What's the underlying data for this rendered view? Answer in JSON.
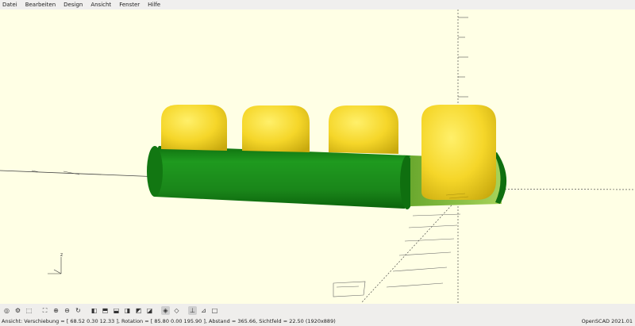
{
  "menu": [
    "Datei",
    "Bearbeiten",
    "Design",
    "Ansicht",
    "Fenster",
    "Hilfe"
  ],
  "viewport": {
    "background": "#ffffe5",
    "colors": {
      "green": "#1e8d1e",
      "yellow": "#f4d62a",
      "side_green": "#9acd50"
    },
    "axis_label_z": "z"
  },
  "toolbar": [
    {
      "name": "preview-icon"
    },
    {
      "name": "render-icon"
    },
    {
      "name": "export-stl-icon"
    },
    {
      "name": "view-all-icon"
    },
    {
      "name": "zoom-in-icon"
    },
    {
      "name": "zoom-out-icon"
    },
    {
      "name": "reset-view-icon"
    },
    {
      "name": "view-right-icon"
    },
    {
      "name": "view-top-icon"
    },
    {
      "name": "view-bottom-icon"
    },
    {
      "name": "view-left-icon"
    },
    {
      "name": "view-front-icon"
    },
    {
      "name": "view-back-icon"
    },
    {
      "name": "perspective-icon"
    },
    {
      "name": "orthogonal-icon"
    },
    {
      "name": "show-axes-icon"
    },
    {
      "name": "show-scale-icon"
    },
    {
      "name": "show-edges-icon"
    }
  ],
  "status": {
    "left": "Ansicht: Verschiebung = [ 68.52 0.30 12.33 ], Rotation = [ 85.80 0.00 195.90 ], Abstand = 365.66, Sichtfeld = 22.50 (1920x889)",
    "right": "OpenSCAD 2021.01"
  }
}
